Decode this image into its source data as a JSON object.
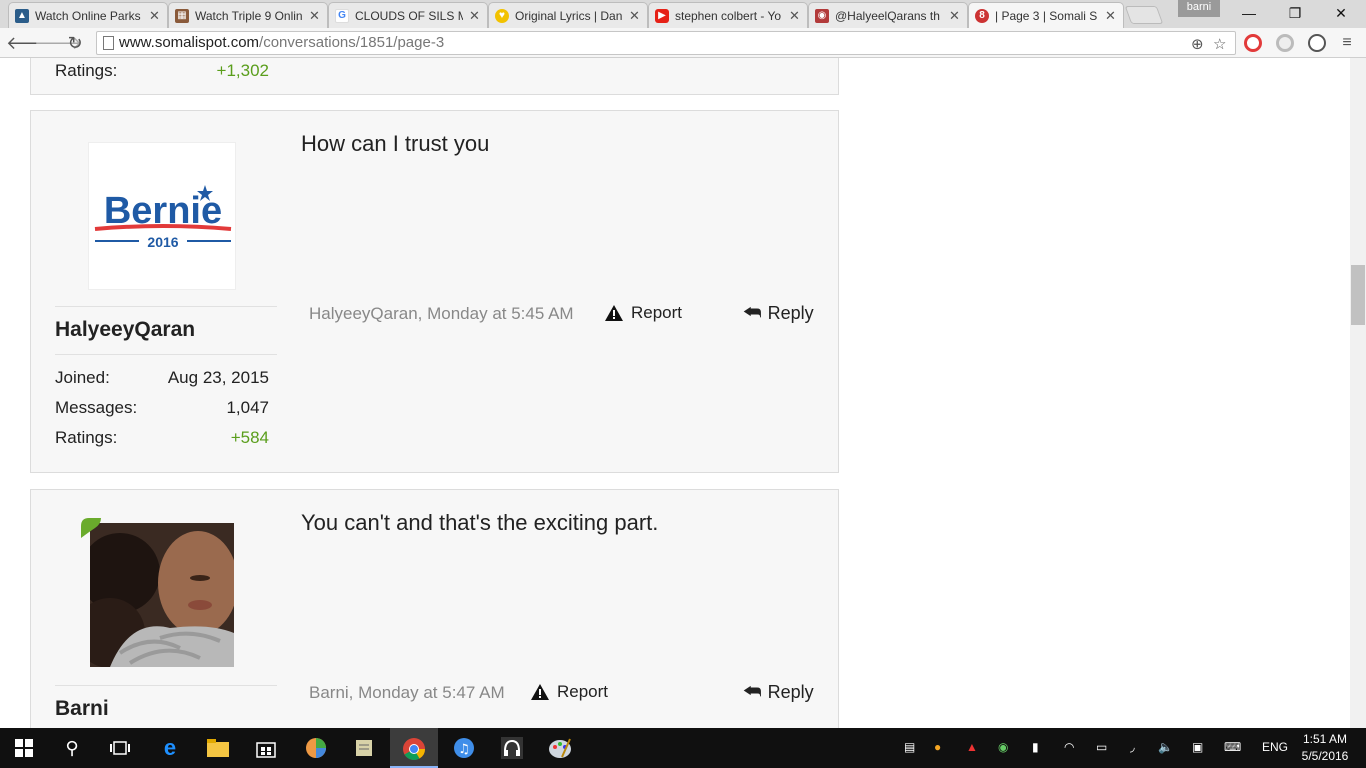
{
  "browser": {
    "tabs": [
      {
        "title": "Watch Online Parks",
        "favicon": "watch-online-icon"
      },
      {
        "title": "Watch Triple 9 Onlin",
        "favicon": "film-icon"
      },
      {
        "title": "CLOUDS OF SILS M",
        "favicon": "google-icon"
      },
      {
        "title": "Original Lyrics | Dan",
        "favicon": "lyrics-icon"
      },
      {
        "title": "stephen colbert - Yo",
        "favicon": "youtube-icon"
      },
      {
        "title": "@HalyeelQarans th",
        "favicon": "instagram-icon"
      },
      {
        "title": "| Page 3 | Somali S",
        "favicon": "somalispot-icon",
        "active": true
      }
    ],
    "profile_name": "barni",
    "url_domain": "www.somalispot.com",
    "url_path": "/conversations/1851/page-3",
    "window_controls": {
      "minimize": "—",
      "restore": "❐",
      "close": "✕"
    }
  },
  "top_partial": {
    "stat_label": "Ratings:",
    "stat_value": "+1,302"
  },
  "posts": [
    {
      "username": "HalyeeyQaran",
      "avatar_text": "Bernie",
      "avatar_year": "2016",
      "message": "How can I trust you",
      "meta": "HalyeeyQaran, Monday at 5:45 AM",
      "report_label": "Report",
      "reply_label": "Reply",
      "stats": [
        {
          "label": "Joined:",
          "value": "Aug 23, 2015"
        },
        {
          "label": "Messages:",
          "value": "1,047"
        },
        {
          "label": "Ratings:",
          "value": "+584"
        }
      ]
    },
    {
      "username": "Barni",
      "message": "You can't and that's the exciting part.",
      "meta": "Barni, Monday at 5:47 AM",
      "report_label": "Report",
      "reply_label": "Reply"
    }
  ],
  "taskbar": {
    "language": "ENG",
    "time": "1:51 AM",
    "date": "5/5/2016"
  },
  "colors": {
    "ratings_green": "#5a9e1c",
    "bernie_blue": "#1f5aa5",
    "bernie_red": "#e23a3a",
    "online_indicator": "#6aab2c"
  }
}
